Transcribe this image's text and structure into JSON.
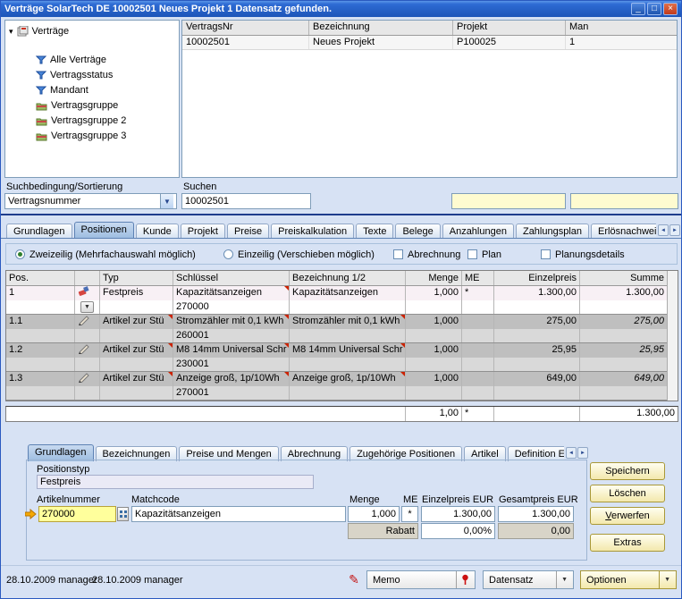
{
  "window": {
    "title": "Verträge SolarTech DE 10002501 Neues Projekt   1 Datensatz gefunden.",
    "minimize_glyph": "_",
    "maximize_glyph": "□",
    "close_glyph": "×"
  },
  "tree": {
    "root_label": "Verträge",
    "items": [
      {
        "label": "Alle Verträge",
        "icon": "filter-icon"
      },
      {
        "label": "Vertragsstatus",
        "icon": "filter-icon"
      },
      {
        "label": "Mandant",
        "icon": "filter-icon"
      },
      {
        "label": "Vertragsgruppe",
        "icon": "folder-icon"
      },
      {
        "label": "Vertragsgruppe 2",
        "icon": "folder-icon"
      },
      {
        "label": "Vertragsgruppe 3",
        "icon": "folder-icon"
      }
    ]
  },
  "results": {
    "columns": [
      "VertragsNr",
      "Bezeichnung",
      "Projekt",
      "Man"
    ],
    "rows": [
      [
        "10002501",
        "Neues Projekt",
        "P100025",
        "1"
      ]
    ]
  },
  "search": {
    "sort_label": "Suchbedingung/Sortierung",
    "sort_value": "Vertragsnummer",
    "find_label": "Suchen",
    "find_value": "10002501"
  },
  "main_tabs": {
    "items": [
      "Grundlagen",
      "Positionen",
      "Kunde",
      "Projekt",
      "Preise",
      "Preiskalkulation",
      "Texte",
      "Belege",
      "Anzahlungen",
      "Zahlungsplan",
      "Erlösnachweis"
    ],
    "active": "Positionen"
  },
  "options": {
    "zweizeilig": "Zweizeilig (Mehrfachauswahl möglich)",
    "einzeilig": "Einzeilig (Verschieben möglich)",
    "abrechnung": "Abrechnung",
    "plan": "Plan",
    "planungsdetails": "Planungsdetails"
  },
  "positions": {
    "columns": [
      "Pos.",
      "Typ",
      "Schlüssel",
      "Bezeichnung 1/2",
      "Menge",
      "ME",
      "Einzelpreis",
      "Summe"
    ],
    "rows": [
      {
        "pos": "1",
        "typ": "Festpreis",
        "schl": "Kapazitätsanzeigen",
        "artnr": "270000",
        "bez": "Kapazitätsanzeigen",
        "menge": "1,000",
        "me": "*",
        "ep": "1.300,00",
        "summe": "1.300,00"
      },
      {
        "pos": "1.1",
        "typ": "Artikel zur Stü",
        "schl": "Stromzähler mit 0,1 kWh",
        "artnr": "260001",
        "bez": "Stromzähler mit 0,1 kWh",
        "menge": "1,000",
        "me": "",
        "ep": "275,00",
        "summe": "275,00"
      },
      {
        "pos": "1.2",
        "typ": "Artikel zur Stü",
        "schl": "M8 14mm Universal Schr",
        "artnr": "230001",
        "bez": "M8 14mm Universal Schr",
        "menge": "1,000",
        "me": "",
        "ep": "25,95",
        "summe": "25,95"
      },
      {
        "pos": "1.3",
        "typ": "Artikel zur Stü",
        "schl": "Anzeige groß, 1p/10Wh",
        "artnr": "270001",
        "bez": "Anzeige groß, 1p/10Wh",
        "menge": "1,000",
        "me": "",
        "ep": "649,00",
        "summe": "649,00"
      }
    ],
    "total": {
      "menge": "1,00",
      "me": "*",
      "summe": "1.300,00"
    }
  },
  "detail_tabs": {
    "items": [
      "Grundlagen",
      "Bezeichnungen",
      "Preise und Mengen",
      "Abrechnung",
      "Zugehörige Positionen",
      "Artikel",
      "Definition Erlösn"
    ],
    "active": "Grundlagen"
  },
  "form": {
    "positionstyp_label": "Positionstyp",
    "positionstyp_value": "Festpreis",
    "artikelnummer_label": "Artikelnummer",
    "artikelnummer_value": "270000",
    "matchcode_label": "Matchcode",
    "matchcode_value": "Kapazitätsanzeigen",
    "menge_label": "Menge",
    "menge_value": "1,000",
    "me_label": "ME",
    "me_value": "*",
    "einzelpreis_label": "Einzelpreis EUR",
    "einzelpreis_value": "1.300,00",
    "gesamtpreis_label": "Gesamtpreis EUR",
    "gesamtpreis_value": "1.300,00",
    "rabatt_label": "Rabatt",
    "rabatt_pct": "0,00%",
    "rabatt_value": "0,00"
  },
  "actions": {
    "speichern": "Speichern",
    "loeschen": "Löschen",
    "verwerfen": "Verwerfen",
    "extras": "Extras"
  },
  "statusbar": {
    "created": "28.10.2009 manager",
    "modified": "28.10.2009 manager",
    "memo": "Memo",
    "datensatz": "Datensatz",
    "optionen": "Optionen"
  }
}
